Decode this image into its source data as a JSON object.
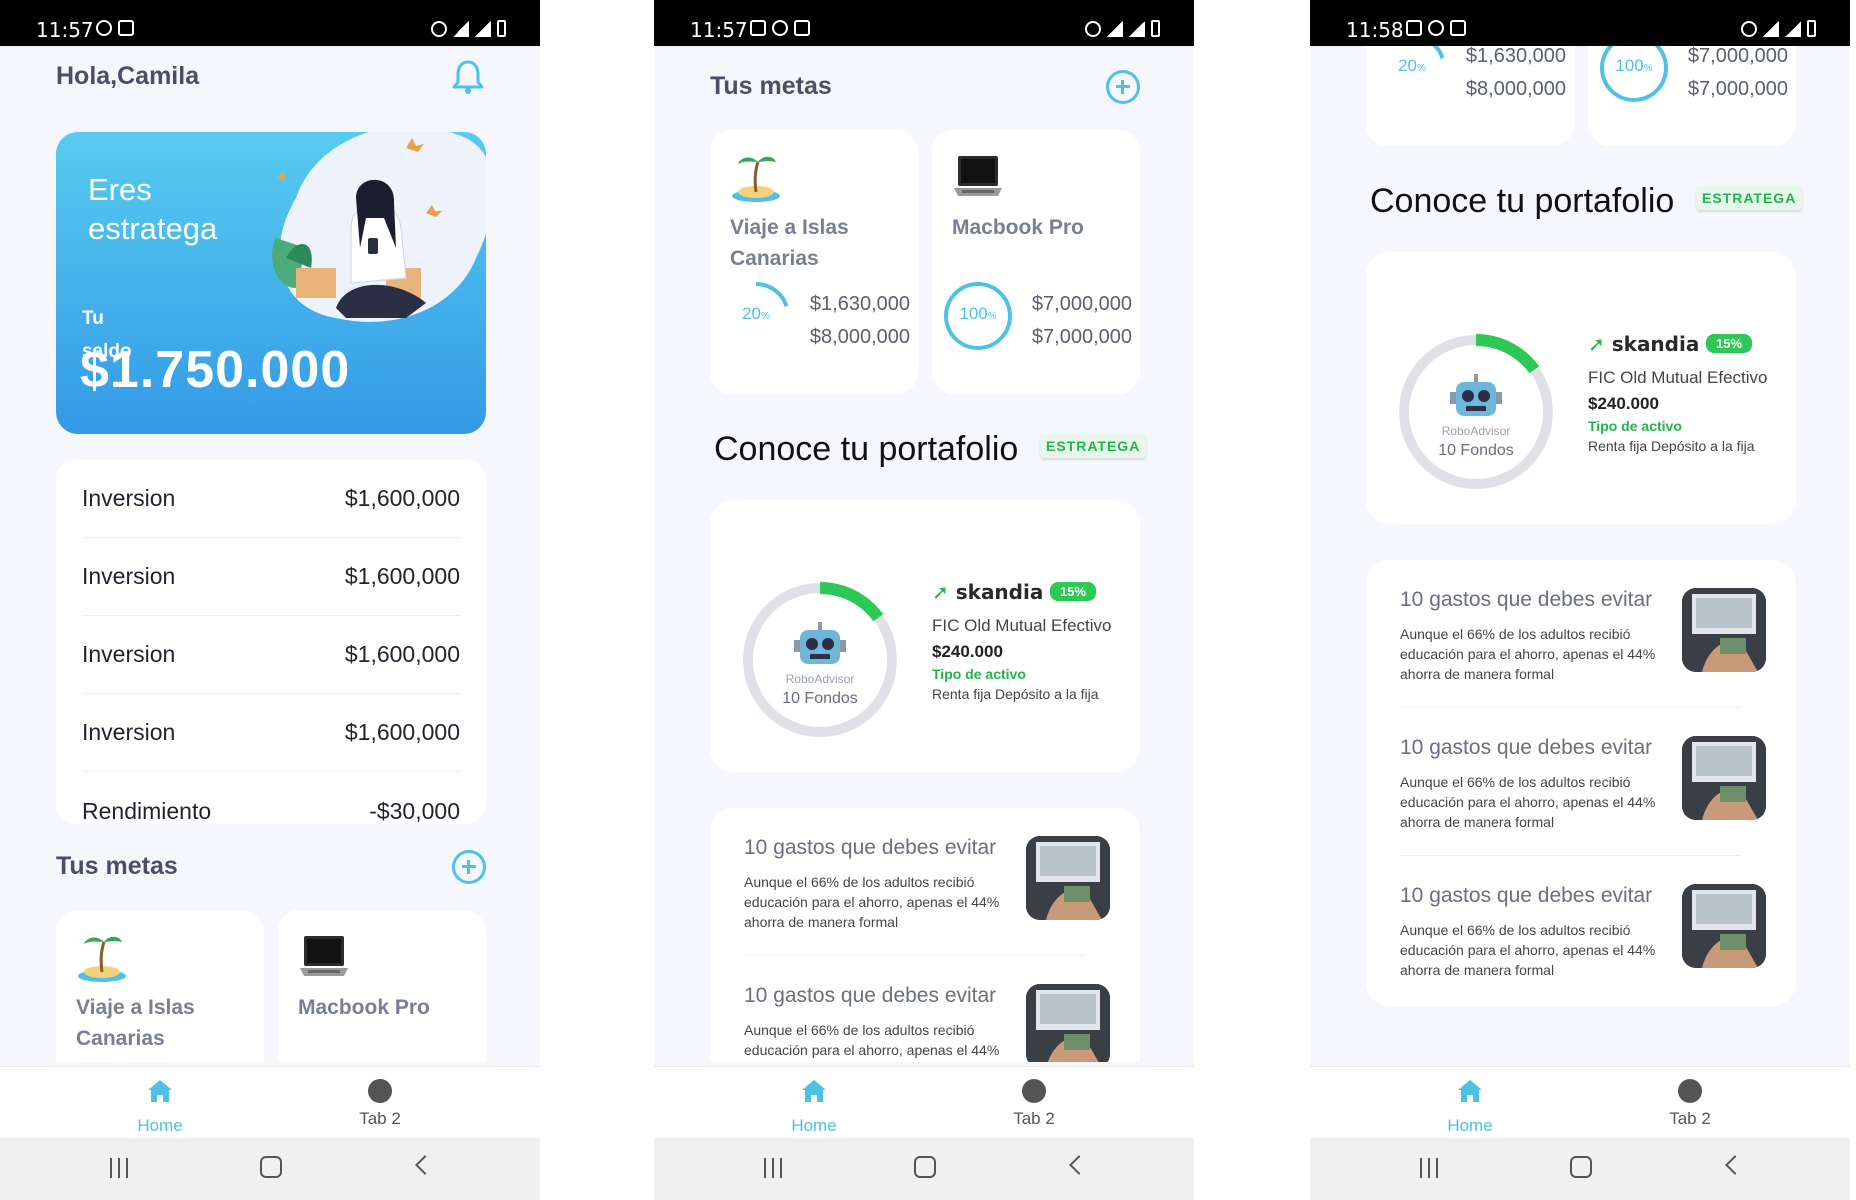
{
  "status": [
    {
      "time": "11:57"
    },
    {
      "time": "11:57"
    },
    {
      "time": "11:58"
    }
  ],
  "home": {
    "greeting": "Hola,Camila",
    "hero": {
      "title": "Eres estratega",
      "balance_label": "Tu saldo",
      "balance": "$1.750.000"
    },
    "investments": [
      {
        "label": "Inversion",
        "value": "$1,600,000"
      },
      {
        "label": "Inversion",
        "value": "$1,600,000"
      },
      {
        "label": "Inversion",
        "value": "$1,600,000"
      },
      {
        "label": "Inversion",
        "value": "$1,600,000"
      },
      {
        "label": "Rendimiento",
        "value": "-$30,000"
      }
    ]
  },
  "goals": {
    "title": "Tus metas",
    "items": [
      {
        "name": "Viaje a Islas Canarias",
        "percent": 20,
        "percent_text": "20",
        "saved": "$1,630,000",
        "target": "$8,000,000"
      },
      {
        "name": "Macbook Pro",
        "percent": 100,
        "percent_text": "100",
        "saved": "$7,000,000",
        "target": "$7,000,000"
      }
    ],
    "percent_symbol": "%"
  },
  "portfolio": {
    "title": "Conoce tu portafolio",
    "badge": "ESTRATEGA",
    "advisor_label": "RoboAdvisor",
    "funds_label": "10 Fondos",
    "brand": "skandia",
    "pct": "15%",
    "pct_value": 15,
    "fund_name": "FIC Old Mutual Efectivo",
    "price": "$240.000",
    "type_label": "Tipo de activo",
    "type_value": "Renta fija Depósito a la fija"
  },
  "articles": {
    "title": "10 gastos que debes evitar",
    "body": "Aunque el 66% de los adultos recibió educación para el ahorro, apenas el 44% ahorra de manera formal"
  },
  "tabs": {
    "home": "Home",
    "tab2": "Tab 2"
  },
  "colors": {
    "accent": "#4fc0e8",
    "green": "#2ec857",
    "hero_top": "#57ccf0",
    "hero_bottom": "#339ae6"
  }
}
